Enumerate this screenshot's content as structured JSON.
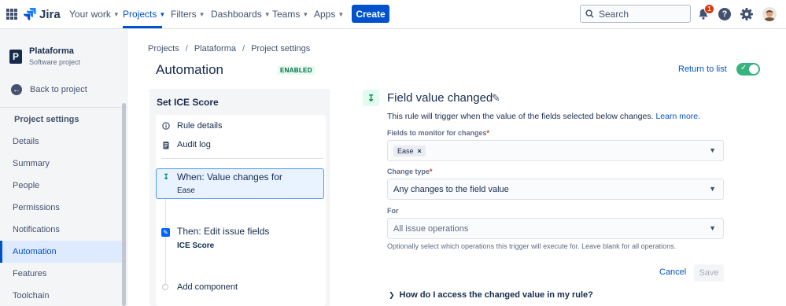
{
  "topnav": {
    "logo": "Jira",
    "items": [
      {
        "label": "Your work"
      },
      {
        "label": "Projects"
      },
      {
        "label": "Filters"
      },
      {
        "label": "Dashboards"
      },
      {
        "label": "Teams"
      },
      {
        "label": "Apps"
      }
    ],
    "create_label": "Create",
    "search_placeholder": "Search",
    "notification_count": "1",
    "help_glyph": "?",
    "accent": "#0052cc"
  },
  "sidebar": {
    "project_initial": "P",
    "project_name": "Plataforma",
    "project_type": "Software project",
    "back_label": "Back to project",
    "heading": "Project settings",
    "items": [
      {
        "label": "Details"
      },
      {
        "label": "Summary"
      },
      {
        "label": "People"
      },
      {
        "label": "Permissions"
      },
      {
        "label": "Notifications"
      },
      {
        "label": "Automation"
      },
      {
        "label": "Features"
      },
      {
        "label": "Toolchain"
      }
    ],
    "active_item": "Automation"
  },
  "header": {
    "breadcrumb": [
      "Projects",
      "Plataforma",
      "Project settings"
    ],
    "separator": "/",
    "title": "Automation",
    "status": "ENABLED",
    "return_label": "Return to list",
    "toggle_on": true
  },
  "rule": {
    "name": "Set ICE Score",
    "links": [
      {
        "label": "Rule details",
        "icon": "info-icon"
      },
      {
        "label": "Audit log",
        "icon": "clipboard-icon"
      }
    ],
    "trigger": {
      "label": "When: Value changes for",
      "detail": "Ease"
    },
    "action": {
      "label": "Then: Edit issue fields",
      "detail": "ICE Score"
    },
    "add_label": "Add component"
  },
  "config": {
    "title": "Field value changed",
    "description": "This rule will trigger when the value of the fields selected below changes.",
    "learn_more": "Learn more.",
    "fields_label": "Fields to monitor for changes",
    "fields_selected": [
      "Ease"
    ],
    "change_type_label": "Change type",
    "change_type_value": "Any changes to the field value",
    "for_label": "For",
    "for_placeholder": "All issue operations",
    "for_help": "Optionally select which operations this trigger will execute for. Leave blank for all operations.",
    "cancel_label": "Cancel",
    "save_label": "Save",
    "faq_label": "How do I access the changed value in my rule?"
  }
}
